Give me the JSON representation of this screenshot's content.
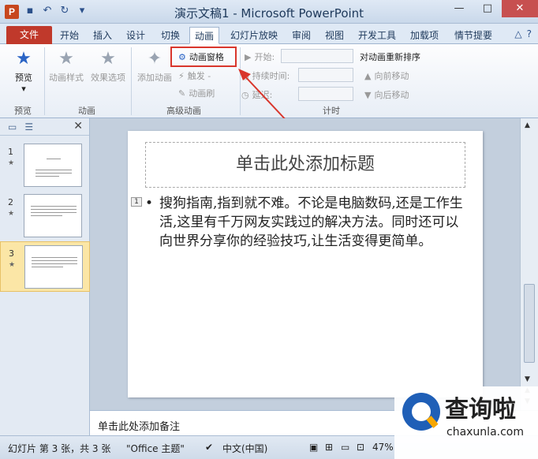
{
  "window": {
    "title": "演示文稿1 - Microsoft PowerPoint",
    "app_icon_letter": "P"
  },
  "tabs": [
    "文件",
    "开始",
    "插入",
    "设计",
    "切换",
    "动画",
    "幻灯片放映",
    "审阅",
    "视图",
    "开发工具",
    "加载项",
    "情节提要"
  ],
  "active_tab": "动画",
  "ribbon": {
    "preview": {
      "label": "预览",
      "group": "预览"
    },
    "animation_group": {
      "styles": "动画样式",
      "effects": "效果选项",
      "group": "动画"
    },
    "advanced": {
      "add": "添加动画",
      "pane": "动画窗格",
      "trigger": "触发 -",
      "painter": "动画刷",
      "group": "高级动画"
    },
    "timing": {
      "start": "开始:",
      "duration": "持续时间:",
      "delay": "延迟:",
      "reorder": "对动画重新排序",
      "earlier": "向前移动",
      "later": "向后移动",
      "group": "计时"
    }
  },
  "slides": [
    {
      "num": "1"
    },
    {
      "num": "2"
    },
    {
      "num": "3"
    }
  ],
  "selected_slide": 3,
  "slide": {
    "title_placeholder": "单击此处添加标题",
    "anim_tag": "1",
    "bullet": "•",
    "body": "搜狗指南,指到就不难。不论是电脑数码,还是工作生活,这里有千万网友实践过的解决方法。同时还可以向世界分享你的经验技巧,让生活变得更简单。"
  },
  "notes_placeholder": "单击此处添加备注",
  "status": {
    "slide_info": "幻灯片 第 3 张，共 3 张",
    "theme": "\"Office 主题\"",
    "language": "中文(中国)",
    "zoom": "47%"
  },
  "watermark": {
    "text": "查询啦",
    "url": "chaxunla.com"
  },
  "colors": {
    "file_tab": "#c0392b",
    "highlight": "#d9362c",
    "accent": "#2a64c5"
  }
}
